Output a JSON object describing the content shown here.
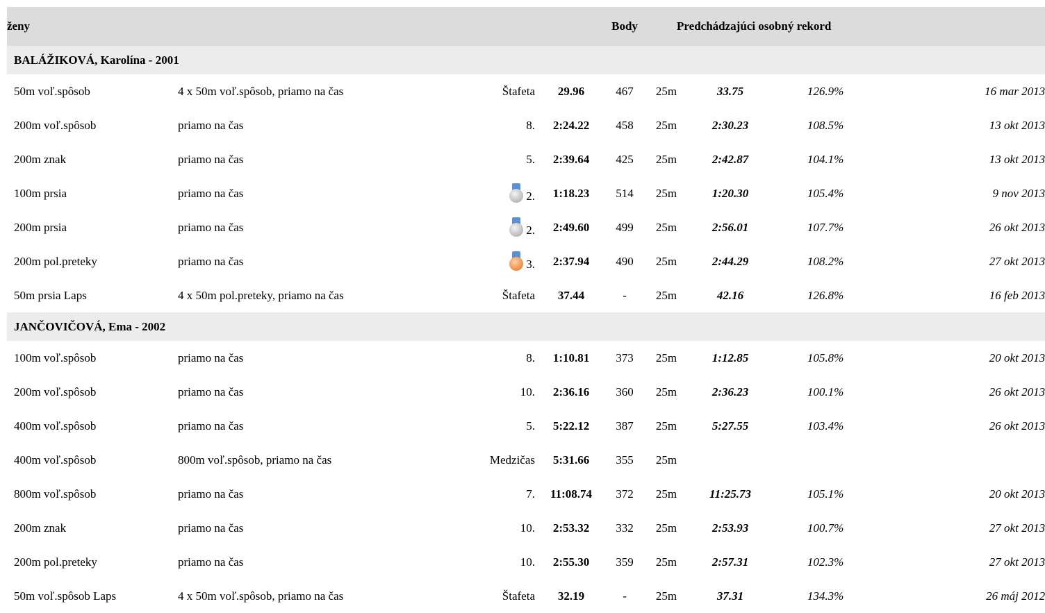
{
  "header": {
    "group": "ženy",
    "points": "Body",
    "previous_pb": "Predchádzajúci osobný rekord"
  },
  "athletes": [
    {
      "name": "BALÁŽIKOVÁ, Karolína - 2001",
      "results": [
        {
          "event": "50m voľ.spôsob",
          "heat": "4 x 50m voľ.spôsob, priamo na čas",
          "place": "Štafeta",
          "medal": "",
          "time": "29.96",
          "points": "467",
          "course": "25m",
          "pb": "33.75",
          "pct": "126.9%",
          "date": "16 mar 2013"
        },
        {
          "event": "200m voľ.spôsob",
          "heat": "priamo na čas",
          "place": "8.",
          "medal": "",
          "time": "2:24.22",
          "points": "458",
          "course": "25m",
          "pb": "2:30.23",
          "pct": "108.5%",
          "date": "13 okt 2013"
        },
        {
          "event": "200m znak",
          "heat": "priamo na čas",
          "place": "5.",
          "medal": "",
          "time": "2:39.64",
          "points": "425",
          "course": "25m",
          "pb": "2:42.87",
          "pct": "104.1%",
          "date": "13 okt 2013"
        },
        {
          "event": "100m prsia",
          "heat": "priamo na čas",
          "place": "2.",
          "medal": "silver",
          "time": "1:18.23",
          "points": "514",
          "course": "25m",
          "pb": "1:20.30",
          "pct": "105.4%",
          "date": "9 nov 2013"
        },
        {
          "event": "200m prsia",
          "heat": "priamo na čas",
          "place": "2.",
          "medal": "silver",
          "time": "2:49.60",
          "points": "499",
          "course": "25m",
          "pb": "2:56.01",
          "pct": "107.7%",
          "date": "26 okt 2013"
        },
        {
          "event": "200m pol.preteky",
          "heat": "priamo na čas",
          "place": "3.",
          "medal": "bronze",
          "time": "2:37.94",
          "points": "490",
          "course": "25m",
          "pb": "2:44.29",
          "pct": "108.2%",
          "date": "27 okt 2013"
        },
        {
          "event": "50m prsia Laps",
          "heat": "4 x 50m pol.preteky, priamo na čas",
          "place": "Štafeta",
          "medal": "",
          "time": "37.44",
          "points": "-",
          "course": "25m",
          "pb": "42.16",
          "pct": "126.8%",
          "date": "16 feb 2013"
        }
      ]
    },
    {
      "name": "JANČOVIČOVÁ, Ema - 2002",
      "results": [
        {
          "event": "100m voľ.spôsob",
          "heat": "priamo na čas",
          "place": "8.",
          "medal": "",
          "time": "1:10.81",
          "points": "373",
          "course": "25m",
          "pb": "1:12.85",
          "pct": "105.8%",
          "date": "20 okt 2013"
        },
        {
          "event": "200m voľ.spôsob",
          "heat": "priamo na čas",
          "place": "10.",
          "medal": "",
          "time": "2:36.16",
          "points": "360",
          "course": "25m",
          "pb": "2:36.23",
          "pct": "100.1%",
          "date": "26 okt 2013"
        },
        {
          "event": "400m voľ.spôsob",
          "heat": "priamo na čas",
          "place": "5.",
          "medal": "",
          "time": "5:22.12",
          "points": "387",
          "course": "25m",
          "pb": "5:27.55",
          "pct": "103.4%",
          "date": "26 okt 2013"
        },
        {
          "event": "400m voľ.spôsob",
          "heat": "800m voľ.spôsob, priamo na čas",
          "place": "Medzičas",
          "medal": "",
          "time": "5:31.66",
          "points": "355",
          "course": "25m",
          "pb": "",
          "pct": "",
          "date": ""
        },
        {
          "event": "800m voľ.spôsob",
          "heat": "priamo na čas",
          "place": "7.",
          "medal": "",
          "time": "11:08.74",
          "points": "372",
          "course": "25m",
          "pb": "11:25.73",
          "pct": "105.1%",
          "date": "20 okt 2013"
        },
        {
          "event": "200m znak",
          "heat": "priamo na čas",
          "place": "10.",
          "medal": "",
          "time": "2:53.32",
          "points": "332",
          "course": "25m",
          "pb": "2:53.93",
          "pct": "100.7%",
          "date": "27 okt 2013"
        },
        {
          "event": "200m pol.preteky",
          "heat": "priamo na čas",
          "place": "10.",
          "medal": "",
          "time": "2:55.30",
          "points": "359",
          "course": "25m",
          "pb": "2:57.31",
          "pct": "102.3%",
          "date": "27 okt 2013"
        },
        {
          "event": "50m voľ.spôsob Laps",
          "heat": "4 x 50m voľ.spôsob, priamo na čas",
          "place": "Štafeta",
          "medal": "",
          "time": "32.19",
          "points": "-",
          "course": "25m",
          "pb": "37.31",
          "pct": "134.3%",
          "date": "26 máj 2012"
        }
      ]
    }
  ]
}
